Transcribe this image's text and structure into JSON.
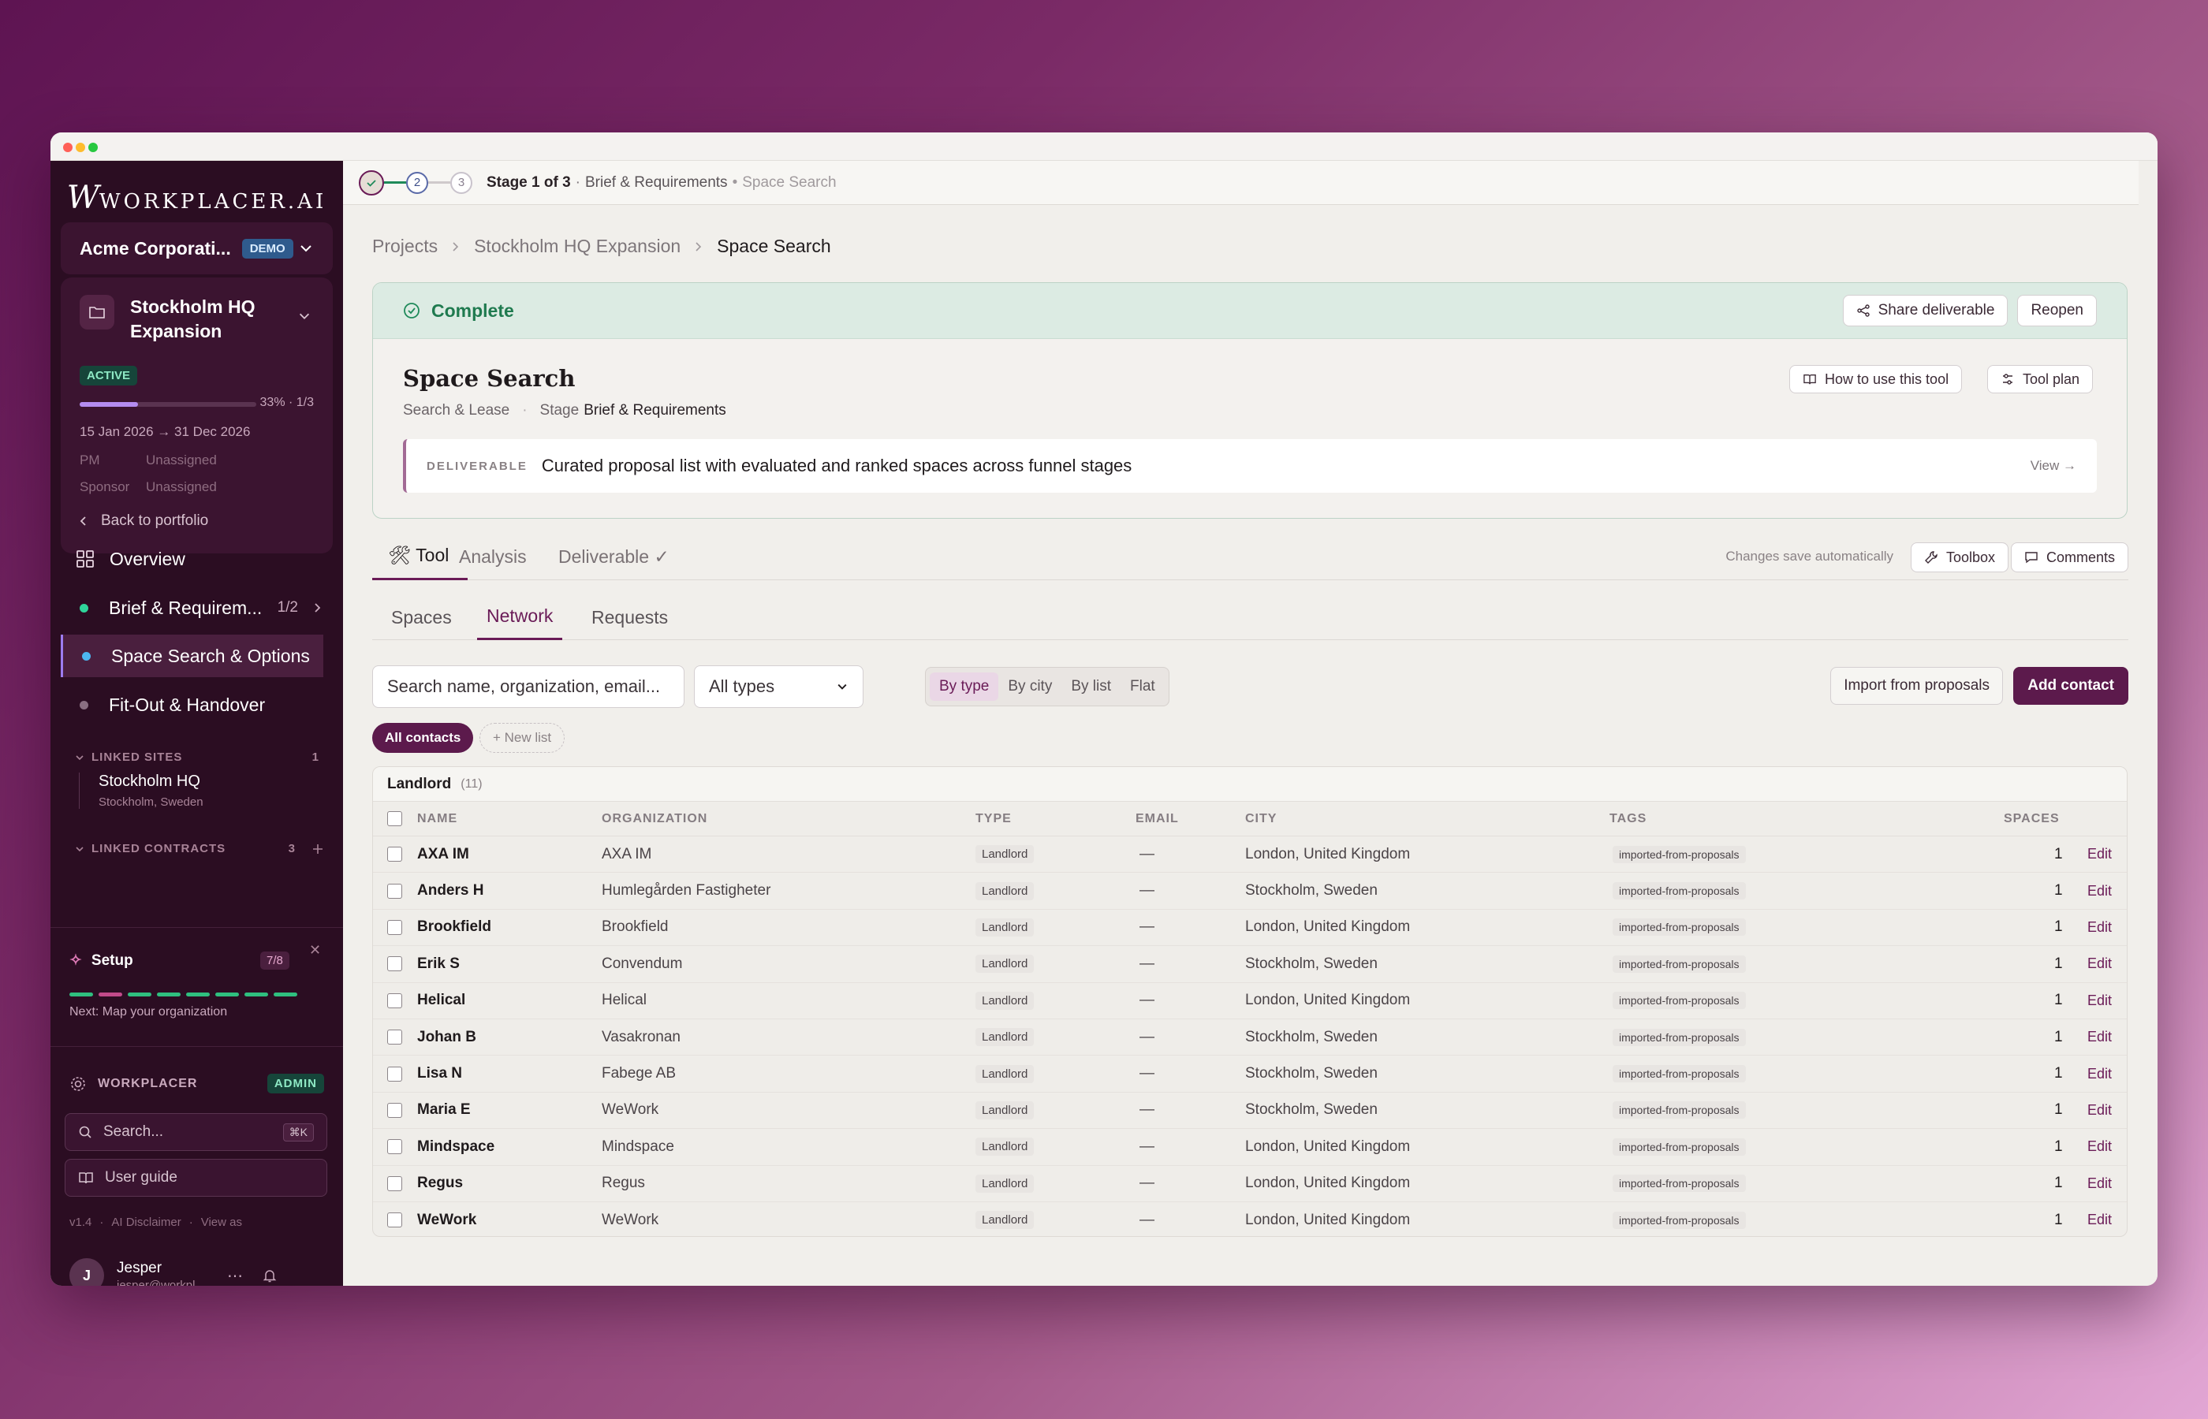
{
  "sidebar": {
    "logo": "WORKPLACER.AI",
    "org_name": "Acme Corporati...",
    "org_badge": "DEMO",
    "project": {
      "title": "Stockholm HQ Expansion",
      "status": "ACTIVE",
      "progress_text": "33% · 1/3",
      "progress_fraction": 0.33,
      "dates": "15 Jan 2026 → 31 Dec 2026",
      "pm_label": "PM",
      "pm_value": "Unassigned",
      "sponsor_label": "Sponsor",
      "sponsor_value": "Unassigned"
    },
    "back_label": "Back to portfolio",
    "overview_label": "Overview",
    "stages": [
      {
        "label": "Brief & Requirem...",
        "count": "1/2",
        "color": "#2fd49a"
      },
      {
        "label": "Space Search & Options",
        "color": "#4cb6f0"
      },
      {
        "label": "Fit-Out & Handover",
        "color": "#8a6f82"
      }
    ],
    "linked_sites_label": "LINKED SITES",
    "linked_sites_count": "1",
    "site_name": "Stockholm HQ",
    "site_location": "Stockholm, Sweden",
    "linked_contracts_label": "LINKED CONTRACTS",
    "linked_contracts_count": "3",
    "setup": {
      "title": "Setup",
      "count": "7/8",
      "next": "Next: Map your organization",
      "segments": [
        "#2fbf7f",
        "#c24a8a",
        "#2fbf7f",
        "#2fbf7f",
        "#2fbf7f",
        "#2fbf7f",
        "#2fbf7f",
        "#2fbf7f"
      ]
    },
    "workplacer_label": "WORKPLACER",
    "admin_badge": "ADMIN",
    "search_placeholder": "Search...",
    "search_shortcut": "⌘K",
    "user_guide": "User guide",
    "footer_links": [
      "v1.4",
      "AI Disclaimer",
      "View as"
    ],
    "user": {
      "initial": "J",
      "name": "Jesper",
      "email": "jesper@workpl..."
    }
  },
  "stepper": {
    "steps": [
      "2",
      "3"
    ],
    "stage_text": "Stage 1 of 3",
    "stage_name": "Brief & Requirements",
    "next_name": "Space Search"
  },
  "breadcrumb": [
    "Projects",
    "Stockholm HQ Expansion",
    "Space Search"
  ],
  "status_card": {
    "status": "Complete",
    "share_label": "Share deliverable",
    "reopen_label": "Reopen",
    "title": "Space Search",
    "category": "Search & Lease",
    "stage_label": "Stage",
    "stage_value": "Brief & Requirements",
    "how_to_label": "How to use this tool",
    "tool_plan_label": "Tool plan",
    "deliverable_tag": "DELIVERABLE",
    "deliverable_text": "Curated proposal list with evaluated and ranked spaces across funnel stages",
    "view_label": "View →"
  },
  "tabs": {
    "items": [
      "🛠 Tool",
      "Analysis",
      "Deliverable ✓"
    ],
    "autosave": "Changes save automatically",
    "toolbox_label": "Toolbox",
    "comments_label": "Comments"
  },
  "subtabs": [
    "Spaces",
    "Network",
    "Requests"
  ],
  "filters": {
    "search_placeholder": "Search name, organization, email...",
    "type_select": "All types",
    "group_modes": [
      "By type",
      "By city",
      "By list",
      "Flat"
    ],
    "import_label": "Import from proposals",
    "add_label": "Add contact",
    "all_contacts": "All contacts",
    "new_list": "+ New list"
  },
  "table": {
    "group_name": "Landlord",
    "group_count": "(11)",
    "columns": [
      "NAME",
      "ORGANIZATION",
      "TYPE",
      "EMAIL",
      "CITY",
      "TAGS",
      "SPACES"
    ],
    "edit_label": "Edit",
    "rows": [
      {
        "name": "AXA IM",
        "org": "AXA IM",
        "type": "Landlord",
        "email": "—",
        "city": "London, United Kingdom",
        "tag": "imported-from-proposals",
        "spaces": "1"
      },
      {
        "name": "Anders H",
        "org": "Humlegården Fastigheter",
        "type": "Landlord",
        "email": "—",
        "city": "Stockholm, Sweden",
        "tag": "imported-from-proposals",
        "spaces": "1"
      },
      {
        "name": "Brookfield",
        "org": "Brookfield",
        "type": "Landlord",
        "email": "—",
        "city": "London, United Kingdom",
        "tag": "imported-from-proposals",
        "spaces": "1"
      },
      {
        "name": "Erik S",
        "org": "Convendum",
        "type": "Landlord",
        "email": "—",
        "city": "Stockholm, Sweden",
        "tag": "imported-from-proposals",
        "spaces": "1"
      },
      {
        "name": "Helical",
        "org": "Helical",
        "type": "Landlord",
        "email": "—",
        "city": "London, United Kingdom",
        "tag": "imported-from-proposals",
        "spaces": "1"
      },
      {
        "name": "Johan B",
        "org": "Vasakronan",
        "type": "Landlord",
        "email": "—",
        "city": "Stockholm, Sweden",
        "tag": "imported-from-proposals",
        "spaces": "1"
      },
      {
        "name": "Lisa N",
        "org": "Fabege AB",
        "type": "Landlord",
        "email": "—",
        "city": "Stockholm, Sweden",
        "tag": "imported-from-proposals",
        "spaces": "1"
      },
      {
        "name": "Maria E",
        "org": "WeWork",
        "type": "Landlord",
        "email": "—",
        "city": "Stockholm, Sweden",
        "tag": "imported-from-proposals",
        "spaces": "1"
      },
      {
        "name": "Mindspace",
        "org": "Mindspace",
        "type": "Landlord",
        "email": "—",
        "city": "London, United Kingdom",
        "tag": "imported-from-proposals",
        "spaces": "1"
      },
      {
        "name": "Regus",
        "org": "Regus",
        "type": "Landlord",
        "email": "—",
        "city": "London, United Kingdom",
        "tag": "imported-from-proposals",
        "spaces": "1"
      },
      {
        "name": "WeWork",
        "org": "WeWork",
        "type": "Landlord",
        "email": "—",
        "city": "London, United Kingdom",
        "tag": "imported-from-proposals",
        "spaces": "1"
      }
    ]
  }
}
